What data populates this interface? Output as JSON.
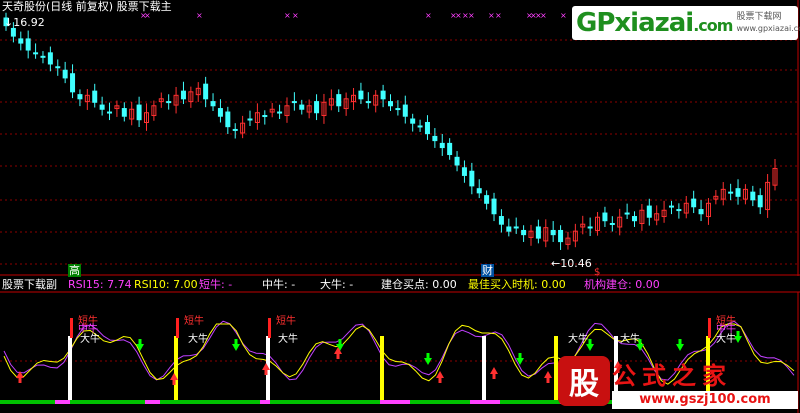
{
  "chart_title": "天奇股份(日线 前复权) 股票下载主",
  "price_high_label": "16.92",
  "price_low_label": "←10.46",
  "marker_gao": "高",
  "marker_cai": "财",
  "marker_s": "$",
  "watermark": {
    "brand": "GPxiazai",
    "tld": ".com",
    "sub1": "股票下载网",
    "sub2": "www.gpxiazai.com"
  },
  "sub_title": "股票下载副",
  "indicators": [
    {
      "label": "RSI15: 7.74",
      "color": "#ff40ff"
    },
    {
      "label": "RSI10: 7.00",
      "color": "#ffff00"
    },
    {
      "label": "短牛: -",
      "color": "#ff40ff"
    },
    {
      "label": "中牛: -",
      "color": "#ffffff"
    },
    {
      "label": "大牛: -",
      "color": "#ffffff"
    },
    {
      "label": "建仓买点: 0.00",
      "color": "#ffffff"
    },
    {
      "label": "最佳买入时机: 0.00",
      "color": "#ffff00"
    },
    {
      "label": "机构建仓: 0.00",
      "color": "#ff40ff"
    }
  ],
  "signal_labels": {
    "short": "短牛",
    "mid": "中牛",
    "big": "大牛"
  },
  "footer_logo": {
    "seal": "股",
    "name": "公式之家",
    "url": "www.gszj100.com"
  },
  "colors": {
    "up": "#ff3030",
    "down": "#40ffff",
    "grid": "#8b0000",
    "green": "#00ff00"
  },
  "chart_data": {
    "type": "candlestick",
    "y_labels_visible": [
      "16.92",
      "10.46"
    ],
    "closes": [
      16.7,
      16.4,
      16.2,
      16.0,
      15.9,
      15.8,
      15.6,
      15.5,
      15.2,
      14.8,
      14.6,
      14.7,
      14.5,
      14.3,
      14.2,
      14.4,
      14.1,
      14.3,
      14.0,
      14.2,
      14.4,
      14.6,
      14.5,
      14.7,
      14.6,
      14.8,
      14.9,
      14.6,
      14.4,
      14.1,
      13.8,
      13.7,
      13.9,
      14.0,
      14.2,
      14.1,
      14.3,
      14.2,
      14.4,
      14.5,
      14.3,
      14.4,
      14.2,
      14.5,
      14.6,
      14.4,
      14.6,
      14.7,
      14.6,
      14.5,
      14.7,
      14.6,
      14.4,
      14.3,
      14.1,
      13.9,
      13.8,
      13.6,
      13.4,
      13.2,
      13.0,
      12.7,
      12.4,
      12.1,
      11.9,
      11.6,
      11.3,
      11.0,
      10.8,
      10.9,
      10.7,
      10.8,
      10.6,
      10.9,
      10.7,
      10.5,
      10.6,
      10.8,
      11.0,
      10.9,
      11.2,
      11.1,
      11.0,
      11.2,
      11.3,
      11.1,
      11.4,
      11.2,
      11.3,
      11.4,
      11.5,
      11.4,
      11.6,
      11.5,
      11.3,
      11.6,
      11.8,
      12.0,
      11.9,
      11.8,
      12.0,
      11.7,
      11.5,
      12.2,
      12.6
    ]
  }
}
